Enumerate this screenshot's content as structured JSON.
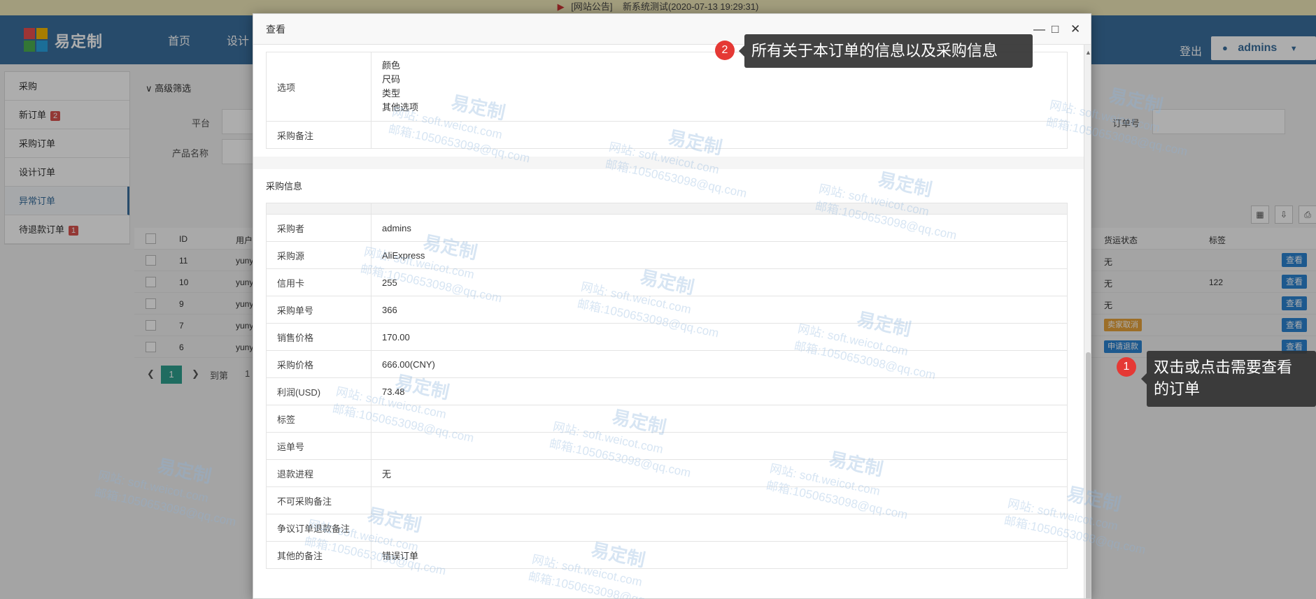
{
  "notice": {
    "label": "[网站公告]",
    "text": "新系统测试(2020-07-13 19:29:31)"
  },
  "header": {
    "logo_text": "易定制",
    "nav": [
      "首页",
      "设计"
    ],
    "login_label": "登出",
    "user_label": "admins"
  },
  "sidebar": {
    "items": [
      {
        "label": "采购",
        "badge": ""
      },
      {
        "label": "新订单",
        "badge": "2"
      },
      {
        "label": "采购订单",
        "badge": ""
      },
      {
        "label": "设计订单",
        "badge": ""
      },
      {
        "label": "异常订单",
        "badge": ""
      },
      {
        "label": "待退款订单",
        "badge": "1"
      }
    ]
  },
  "filter": {
    "title": "高级筛选",
    "platform_label": "平台",
    "product_label": "产品名称",
    "order_no_label": "订单号"
  },
  "table": {
    "headers": {
      "id": "ID",
      "user": "用户",
      "shipping": "货运状态",
      "tag": "标签"
    },
    "rows": [
      {
        "id": "11",
        "user": "yuny",
        "shipping": "无",
        "tag": "",
        "status_tag": ""
      },
      {
        "id": "10",
        "user": "yuny",
        "shipping": "无",
        "tag": "122",
        "status_tag": ""
      },
      {
        "id": "9",
        "user": "yuny",
        "shipping": "无",
        "tag": "",
        "status_tag": ""
      },
      {
        "id": "7",
        "user": "yuny",
        "shipping": "",
        "tag": "",
        "status_tag": "卖家取消"
      },
      {
        "id": "6",
        "user": "yuny",
        "shipping": "",
        "tag": "",
        "status_tag": "申请退款"
      }
    ],
    "view_label": "查看",
    "pager": {
      "current": "1",
      "goto_label": "到第",
      "goto_value": "1"
    }
  },
  "modal": {
    "title": "查看",
    "order_section": {
      "rows": [
        {
          "key": "选项",
          "values": [
            "颜色",
            "尺码",
            "类型",
            "其他选项"
          ]
        },
        {
          "key": "采购备注",
          "values": [
            ""
          ]
        }
      ]
    },
    "purchase_section": {
      "title": "采购信息",
      "rows": [
        {
          "key": "采购者",
          "value": "admins"
        },
        {
          "key": "采购源",
          "value": "AliExpress"
        },
        {
          "key": "信用卡",
          "value": "255"
        },
        {
          "key": "采购单号",
          "value": "366"
        },
        {
          "key": "销售价格",
          "value": "170.00"
        },
        {
          "key": "采购价格",
          "value": "666.00(CNY)"
        },
        {
          "key": "利润(USD)",
          "value": "73.48"
        },
        {
          "key": "标签",
          "value": ""
        },
        {
          "key": "运单号",
          "value": ""
        },
        {
          "key": "退款进程",
          "value": "无"
        },
        {
          "key": "不可采购备注",
          "value": ""
        },
        {
          "key": "争议订单退款备注",
          "value": ""
        },
        {
          "key": "其他的备注",
          "value": "错误订单"
        }
      ]
    }
  },
  "tips": {
    "tip1": {
      "num": "1",
      "text_line1": "双击或点击需要查看",
      "text_line2": "的订单"
    },
    "tip2": {
      "num": "2",
      "text": "所有关于本订单的信息以及采购信息"
    }
  },
  "watermark": {
    "brand": "易定制",
    "site": "网站: soft.weicot.com",
    "email": "邮箱:1050653098@qq.com"
  }
}
